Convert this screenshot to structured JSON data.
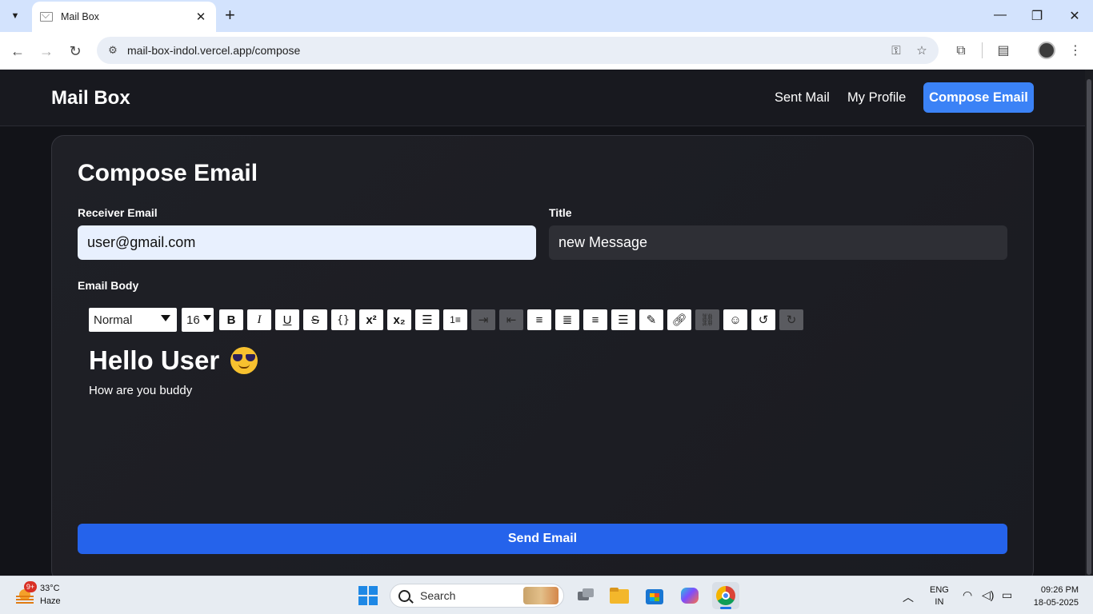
{
  "browser": {
    "tab_title": "Mail Box",
    "tab_close": "✕",
    "new_tab": "+",
    "url": "mail-box-indol.vercel.app/compose"
  },
  "app": {
    "brand": "Mail Box",
    "nav": {
      "sent_mail": "Sent Mail",
      "my_profile": "My Profile",
      "compose_email": "Compose Email"
    },
    "compose": {
      "title": "Compose Email",
      "receiver_label": "Receiver Email",
      "receiver_value": "user@gmail.com",
      "title_label": "Title",
      "title_value": "new Message",
      "body_label": "Email Body",
      "toolbar": {
        "header_select": "Normal",
        "size_select": "16"
      },
      "body_heading": "Hello User",
      "body_text": "How are you buddy",
      "send_label": "Send Email"
    },
    "colors": {
      "accent": "#3b82f6",
      "send": "#2563eb",
      "background": "#121318"
    }
  },
  "taskbar": {
    "weather_badge": "9+",
    "temperature": "33°C",
    "condition": "Haze",
    "search_placeholder": "Search",
    "lang_line1": "ENG",
    "lang_line2": "IN",
    "time": "09:26 PM",
    "date": "18-05-2025"
  }
}
